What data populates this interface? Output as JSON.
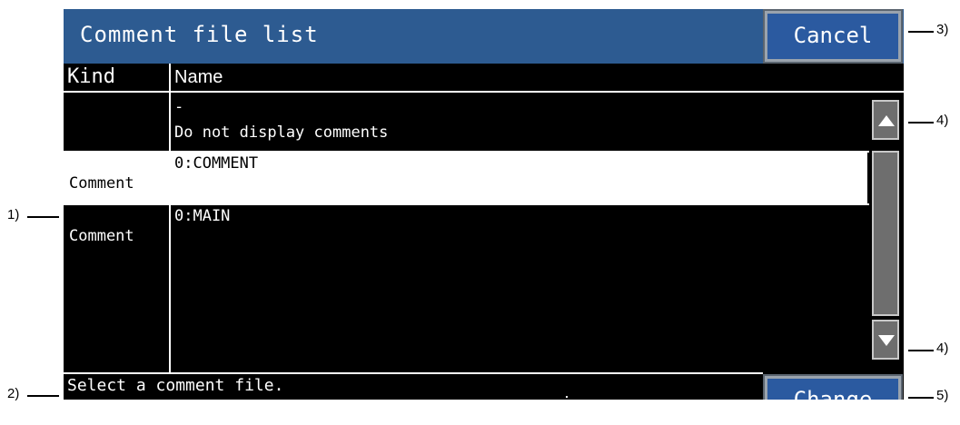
{
  "title": "Comment file list",
  "cancel_label": "Cancel",
  "change_label": "Change",
  "columns": {
    "kind": "Kind",
    "name": "Name"
  },
  "rows": [
    {
      "kind": "",
      "name_line1": "-",
      "name_line2": "Do not display comments"
    },
    {
      "kind": "Comment",
      "name_line1": "0:COMMENT",
      "name_line2": ""
    },
    {
      "kind": "Comment",
      "name_line1": "0:MAIN",
      "name_line2": ""
    }
  ],
  "status": "Select a comment file.",
  "callouts": {
    "c1": "1)",
    "c2": "2)",
    "c3": "3)",
    "c4a": "4)",
    "c4b": "4)",
    "c5": "5)"
  },
  "colors": {
    "titlebar": "#2d5b91",
    "button": "#2b5aa0",
    "background": "#000000",
    "selected_row": "#ffffff"
  },
  "icons": {
    "scroll_up": "triangle-up",
    "scroll_down": "triangle-down"
  }
}
